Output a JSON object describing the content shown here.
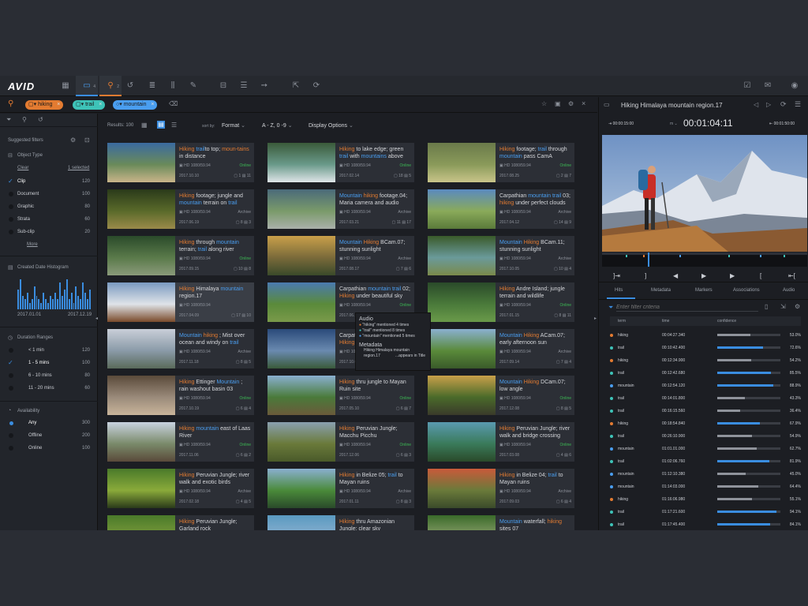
{
  "app": {
    "logo": "AVID"
  },
  "topbar": {
    "icons": [
      "grid-icon",
      "folder-icon",
      "search-icon",
      "history-icon",
      "list-icon",
      "bin-icon",
      "edit-icon",
      "sequence-icon",
      "timeline-icon",
      "arrow-icon",
      "export-icon",
      "refresh-search-icon"
    ],
    "folder_badge": "4",
    "search_badge": "2",
    "right_icons": [
      "check-icon",
      "mail-icon",
      "user-icon"
    ]
  },
  "search": {
    "chips": [
      {
        "label": "hiking",
        "color": "#e37b31"
      },
      {
        "label": "trail",
        "color": "#3ec3b8"
      },
      {
        "label": "mountain",
        "color": "#4a9ef0"
      }
    ]
  },
  "filters": {
    "title": "Suggested filters",
    "object_type": {
      "title": "Object Type",
      "clear": "Clear",
      "selected": "1 selected",
      "items": [
        {
          "label": "Clip",
          "count": "120",
          "checked": true
        },
        {
          "label": "Document",
          "count": "100",
          "checked": false
        },
        {
          "label": "Graphic",
          "count": "80",
          "checked": false
        },
        {
          "label": "Strata",
          "count": "60",
          "checked": false
        },
        {
          "label": "Sub-clip",
          "count": "20",
          "checked": false
        }
      ],
      "more": "More"
    },
    "histogram": {
      "title": "Created Date Histogram",
      "start": "2017.01.01",
      "end": "2017.12.19",
      "values": [
        0.6,
        0.9,
        0.4,
        0.3,
        0.5,
        0.2,
        0.3,
        0.7,
        0.4,
        0.3,
        0.2,
        0.5,
        0.3,
        0.2,
        0.4,
        0.3,
        0.5,
        0.3,
        0.8,
        0.4,
        0.6,
        0.9,
        0.3,
        0.5,
        0.2,
        0.7,
        0.4,
        0.3,
        0.8,
        0.5,
        0.3,
        0.6
      ]
    },
    "duration": {
      "title": "Duration Ranges",
      "items": [
        {
          "label": "< 1 min",
          "count": "120",
          "checked": false
        },
        {
          "label": "1 - 5 mins",
          "count": "100",
          "checked": true
        },
        {
          "label": "6 - 10 mins",
          "count": "80",
          "checked": false
        },
        {
          "label": "11 - 20 mins",
          "count": "60",
          "checked": false
        }
      ]
    },
    "availability": {
      "title": "Availability",
      "items": [
        {
          "label": "Any",
          "count": "300",
          "active": true
        },
        {
          "label": "Offline",
          "count": "200",
          "active": false
        },
        {
          "label": "Online",
          "count": "100",
          "active": false
        }
      ]
    }
  },
  "results": {
    "count_label": "Results: 100",
    "sort_by": "sort by:",
    "sort_value": "Format",
    "order_value": "A - Z, 0 -9",
    "display_options": "Display Options"
  },
  "cards": [
    {
      "title": [
        [
          "o",
          "Hiking"
        ],
        [
          " ",
          ""
        ],
        [
          "b",
          "trail"
        ],
        [
          "",
          "to top; "
        ],
        [
          "o",
          "moun-tains"
        ],
        [
          "",
          " in distance"
        ]
      ],
      "hd": "HD 1080/59.94",
      "status": "Online",
      "date": "2017.10.10",
      "c1": "1",
      "c2": "11",
      "thumb": [
        "#3a6aa0",
        "#6a8a5a",
        "#c9b58a"
      ]
    },
    {
      "title": [
        [
          "o",
          "Hiking"
        ],
        [
          "",
          " to lake edge; green "
        ],
        [
          "b",
          "trail"
        ],
        [
          "",
          " with "
        ],
        [
          "b",
          "mountains"
        ],
        [
          "",
          " above"
        ]
      ],
      "hd": "HD 1080/59.94",
      "status": "Online",
      "date": "2017.02.14",
      "c1": "18",
      "c2": "5",
      "thumb": [
        "#3a5a3a",
        "#6a9a8a",
        "#dfe5e8"
      ]
    },
    {
      "title": [
        [
          "o",
          "Hiking"
        ],
        [
          "",
          " footage; "
        ],
        [
          "b",
          "trail"
        ],
        [
          "",
          " through "
        ],
        [
          "b",
          "mountain"
        ],
        [
          "",
          " pass CamA"
        ]
      ],
      "hd": "HD 1080/59.94",
      "status": "Online",
      "date": "2017.08.25",
      "c1": "2",
      "c2": "7",
      "thumb": [
        "#6a7a4a",
        "#8a9a5a",
        "#c9c58a"
      ]
    },
    {
      "title": [
        [
          "o",
          "Hiking"
        ],
        [
          "",
          " footage; jungle and "
        ],
        [
          "b",
          "mountain"
        ],
        [
          "",
          " terrain on "
        ],
        [
          "b",
          "trail"
        ]
      ],
      "hd": "HD 1080/59.94",
      "status": "Archive",
      "date": "2017.06.19",
      "c1": "8",
      "c2": "3",
      "thumb": [
        "#2a3a1a",
        "#5a6a2a",
        "#9a8a4a"
      ]
    },
    {
      "title": [
        [
          "b",
          "Mountain"
        ],
        [
          " ",
          ""
        ],
        [
          "o",
          "hiking"
        ],
        [
          "",
          " footage.04; Maria camera and audio"
        ]
      ],
      "hd": "HD 1080/59.94",
      "status": "Archive",
      "date": "2017.03.21",
      "c1": "11",
      "c2": "17",
      "thumb": [
        "#4a6a7a",
        "#7a9a6a",
        "#aab0aa"
      ]
    },
    {
      "title": [
        [
          "",
          "Carpathian "
        ],
        [
          "b",
          "mountain trail"
        ],
        [
          "",
          " 03; "
        ],
        [
          "o",
          "hiking"
        ],
        [
          "",
          " under perfect clouds"
        ]
      ],
      "hd": "HD 1080/59.94",
      "status": "Archive",
      "date": "2017.04.12",
      "c1": "14",
      "c2": "9",
      "thumb": [
        "#5a8ac0",
        "#8aaa5a",
        "#5a7a3a"
      ]
    },
    {
      "title": [
        [
          "o",
          "Hiking"
        ],
        [
          "",
          " through "
        ],
        [
          "b",
          "mountain"
        ],
        [
          "",
          " terrain; "
        ],
        [
          "b",
          "trail"
        ],
        [
          "",
          " along river"
        ]
      ],
      "hd": "HD 1080/59.94",
      "status": "Online",
      "date": "2017.09.15",
      "c1": "10",
      "c2": "8",
      "thumb": [
        "#2a4a2a",
        "#5a7a4a",
        "#8a9a7a"
      ]
    },
    {
      "title": [
        [
          "b",
          "Mountain"
        ],
        [
          " ",
          ""
        ],
        [
          "o",
          "Hiking"
        ],
        [
          "",
          " BCam.07; stunning sunlight"
        ]
      ],
      "hd": "HD 1080/59.94",
      "status": "Archive",
      "date": "2017.08.17",
      "c1": "7",
      "c2": "6",
      "thumb": [
        "#c9a04a",
        "#7a6a3a",
        "#3a4a2a"
      ]
    },
    {
      "title": [
        [
          "b",
          "Mountain"
        ],
        [
          " ",
          ""
        ],
        [
          "o",
          "Hiking"
        ],
        [
          "",
          " BCam.11; stunning sunlight"
        ]
      ],
      "hd": "HD 1080/59.94",
      "status": "Archive",
      "date": "2017.10.05",
      "c1": "10",
      "c2": "4",
      "thumb": [
        "#3a5a2a",
        "#6a9a9a",
        "#7a8a4a"
      ]
    },
    {
      "title": [
        [
          "o",
          "Hiking"
        ],
        [
          "",
          " Himalaya "
        ],
        [
          "b",
          "mountain"
        ],
        [
          "",
          " region.17"
        ]
      ],
      "hd": "HD 1080/59.94",
      "status": "",
      "date": "2017.04.09",
      "c1": "17",
      "c2": "10",
      "thumb": [
        "#7a9ac0",
        "#dfe3e8",
        "#7a4a2a"
      ],
      "selected": true
    },
    {
      "title": [
        [
          "",
          "Carpathian "
        ],
        [
          "b",
          "mountain trail"
        ],
        [
          "",
          " 02; "
        ],
        [
          "o",
          "Hiking"
        ],
        [
          "",
          " under beautiful sky"
        ]
      ],
      "hd": "HD 1080/59.94",
      "status": "Online",
      "date": "2017.06.11",
      "c1": "9",
      "c2": "8",
      "thumb": [
        "#4a7ab0",
        "#5a8a3a",
        "#7a9a4a"
      ]
    },
    {
      "title": [
        [
          "o",
          "Hiking"
        ],
        [
          "",
          " Andre Island; jungle terrain and wildlife"
        ]
      ],
      "hd": "HD 1080/59.94",
      "status": "Online",
      "date": "2017.01.15",
      "c1": "8",
      "c2": "11",
      "thumb": [
        "#2a4a2a",
        "#4a7a3a",
        "#6a9a4a"
      ]
    },
    {
      "title": [
        [
          "b",
          "Mountain"
        ],
        [
          " ",
          ""
        ],
        [
          "o",
          "hiking"
        ],
        [
          "",
          " ; Mist over ocean and windy on "
        ],
        [
          "b",
          "trail"
        ]
      ],
      "hd": "HD 1080/59.94",
      "status": "Archive",
      "date": "2017.11.18",
      "c1": "8",
      "c2": "5",
      "thumb": [
        "#c9cfd8",
        "#8a9aa8",
        "#5a6a5a"
      ]
    },
    {
      "title": [
        [
          "",
          "Carpathian "
        ],
        [
          "b",
          "mountains"
        ],
        [
          "",
          " 18; "
        ],
        [
          "o",
          "Hiking"
        ],
        [
          "",
          " under beautiful sky"
        ]
      ],
      "hd": "HD 1080/59.94",
      "status": "Archive",
      "date": "2017.10.02",
      "c1": "14",
      "c2": "4",
      "thumb": [
        "#2a4a7a",
        "#6a8ab0",
        "#3a5a3a"
      ]
    },
    {
      "title": [
        [
          "b",
          "Mountain"
        ],
        [
          " ",
          ""
        ],
        [
          "o",
          "Hiking"
        ],
        [
          "",
          " ACam.07; early afternoon sun"
        ]
      ],
      "hd": "HD 1080/59.94",
      "status": "Archive",
      "date": "2017.09.14",
      "c1": "7",
      "c2": "4",
      "thumb": [
        "#8ab0d0",
        "#5a8a3a",
        "#3a5a2a"
      ]
    },
    {
      "title": [
        [
          "o",
          "Hiking"
        ],
        [
          "",
          " Ettinger "
        ],
        [
          "b",
          "Mountain"
        ],
        [
          "",
          " ; rain washout basin 03"
        ]
      ],
      "hd": "HD 1080/59.94",
      "status": "Online",
      "date": "2017.10.19",
      "c1": "6",
      "c2": "4",
      "thumb": [
        "#5a4a3a",
        "#9a8a7a",
        "#c9b59a"
      ]
    },
    {
      "title": [
        [
          "o",
          "Hiking"
        ],
        [
          "",
          " thru jungle to Mayan Ruin site"
        ]
      ],
      "hd": "HD 1080/59.94",
      "status": "Online",
      "date": "2017.05.10",
      "c1": "6",
      "c2": "7",
      "thumb": [
        "#8ab0d0",
        "#4a7a3a",
        "#6a5a3a"
      ]
    },
    {
      "title": [
        [
          "b",
          "Mountain"
        ],
        [
          " ",
          ""
        ],
        [
          "o",
          "Hiking"
        ],
        [
          "",
          " DCam.07; low angle"
        ]
      ],
      "hd": "HD 1080/59.94",
      "status": "Online",
      "date": "2017.12.08",
      "c1": "8",
      "c2": "5",
      "thumb": [
        "#c9a04a",
        "#4a6a2a",
        "#3a3a2a"
      ]
    },
    {
      "title": [
        [
          "o",
          "Hiking"
        ],
        [
          " ",
          ""
        ],
        [
          "b",
          "mountain"
        ],
        [
          "",
          " east of Laas River"
        ]
      ],
      "hd": "HD 1080/59.94",
      "status": "Online",
      "date": "2017.11.06",
      "c1": "6",
      "c2": "2",
      "thumb": [
        "#c9d3e0",
        "#7a8a6a",
        "#5a4a3a"
      ]
    },
    {
      "title": [
        [
          "o",
          "Hiking"
        ],
        [
          "",
          " Peruvian Jungle; Macchu Picchu"
        ]
      ],
      "hd": "HD 1080/59.94",
      "status": "Online",
      "date": "2017.12.06",
      "c1": "6",
      "c2": "3",
      "thumb": [
        "#8aa0b0",
        "#6a7a3a",
        "#4a5a2a"
      ]
    },
    {
      "title": [
        [
          "o",
          "Hiking"
        ],
        [
          "",
          " Peruvian Jungle; river walk and bridge crossing"
        ]
      ],
      "hd": "HD 1080/59.94",
      "status": "Online",
      "date": "2017.03.08",
      "c1": "4",
      "c2": "6",
      "thumb": [
        "#5a9ab0",
        "#3a7a5a",
        "#2a4a2a"
      ]
    },
    {
      "title": [
        [
          "o",
          "Hiking"
        ],
        [
          "",
          " Peruvian Jungle; river walk and exotic birds"
        ]
      ],
      "hd": "HD 1080/59.94",
      "status": "Archive",
      "date": "2017.02.18",
      "c1": "4",
      "c2": "5",
      "thumb": [
        "#4a7a2a",
        "#8aaa3a",
        "#2a3a1a"
      ]
    },
    {
      "title": [
        [
          "o",
          "Hiking"
        ],
        [
          "",
          " in Belize 05; "
        ],
        [
          "b",
          "trail"
        ],
        [
          "",
          " to Mayan ruins"
        ]
      ],
      "hd": "HD 1080/59.94",
      "status": "Archive",
      "date": "2017.01.11",
      "c1": "8",
      "c2": "3",
      "thumb": [
        "#8ab0d0",
        "#4a8a3a",
        "#2a4a2a"
      ]
    },
    {
      "title": [
        [
          "o",
          "Hiking"
        ],
        [
          "",
          " in Belize 04; "
        ],
        [
          "b",
          "trail"
        ],
        [
          "",
          " to Mayan ruins"
        ]
      ],
      "hd": "HD 1080/59.94",
      "status": "Archive",
      "date": "2017.09.03",
      "c1": "6",
      "c2": "4",
      "thumb": [
        "#c95a3a",
        "#6a7a3a",
        "#3a4a2a"
      ]
    },
    {
      "title": [
        [
          "o",
          "Hiking"
        ],
        [
          "",
          " Peruvian Jungle; Garland rock"
        ]
      ],
      "hd": "",
      "status": "",
      "date": "",
      "c1": "",
      "c2": "",
      "thumb": [
        "#4a7a2a",
        "#7a9a3a",
        "#3a3a2a"
      ]
    },
    {
      "title": [
        [
          "o",
          "Hiking"
        ],
        [
          "",
          " thru Amazonian Jungle; clear sky"
        ]
      ],
      "hd": "",
      "status": "",
      "date": "",
      "c1": "",
      "c2": "",
      "thumb": [
        "#5a9ac0",
        "#8ab0d0",
        "#3a5a2a"
      ]
    },
    {
      "title": [
        [
          "b",
          "Mountain"
        ],
        [
          "",
          " waterfall; "
        ],
        [
          "o",
          "hiking"
        ],
        [
          "",
          " sites 07"
        ]
      ],
      "hd": "",
      "status": "",
      "date": "",
      "c1": "",
      "c2": "",
      "thumb": [
        "#3a6a2a",
        "#8aa06a",
        "#dfe3e0"
      ]
    }
  ],
  "popup": {
    "audio_title": "Audio",
    "audio_lines": [
      {
        "term": "\"hiking\"",
        "rest": " mentioned 4 times",
        "color": "#e37b31"
      },
      {
        "term": "\"trail\"",
        "rest": " mentioned 8 times",
        "color": "#3ec3b8"
      },
      {
        "term": "\"mountain\"",
        "rest": " mentioned 5 times",
        "color": "#4a9ef0"
      }
    ],
    "meta_title": "Metadata",
    "meta_line1": "Hiking Himalaya mountain",
    "meta_line2": "region.17",
    "meta_line3": "...appears in Title"
  },
  "preview": {
    "title": "Hiking Himalaya mountain region.17",
    "tc_in": "00:00:15:00",
    "tc_main": "00:01:04:11",
    "tc_out": "00:01:50:00",
    "tabs": [
      "Hits",
      "Metadata",
      "Markers",
      "Associations",
      "Audio"
    ],
    "filter_placeholder": "Enter filter criteria",
    "columns": [
      "term",
      "time",
      "confidence"
    ],
    "hits": [
      {
        "term": "hiking",
        "time": "00:04:27.340",
        "conf": "53.0%",
        "v": 0.53,
        "color": "#e37b31",
        "blue": false
      },
      {
        "term": "trail",
        "time": "00:10:42.400",
        "conf": "72.6%",
        "v": 0.726,
        "color": "#3ec3b8",
        "blue": true
      },
      {
        "term": "hiking",
        "time": "00:12:34.900",
        "conf": "54.2%",
        "v": 0.542,
        "color": "#e37b31",
        "blue": false
      },
      {
        "term": "trail",
        "time": "00:12:42.680",
        "conf": "85.5%",
        "v": 0.855,
        "color": "#3ec3b8",
        "blue": true
      },
      {
        "term": "mountain",
        "time": "00:12:54.120",
        "conf": "88.9%",
        "v": 0.889,
        "color": "#4a9ef0",
        "blue": true
      },
      {
        "term": "trail",
        "time": "00:14:01.800",
        "conf": "43.3%",
        "v": 0.433,
        "color": "#3ec3b8",
        "blue": false
      },
      {
        "term": "trail",
        "time": "00:16:15.560",
        "conf": "36.4%",
        "v": 0.364,
        "color": "#3ec3b8",
        "blue": false
      },
      {
        "term": "hiking",
        "time": "00:18:54.840",
        "conf": "67.9%",
        "v": 0.679,
        "color": "#e37b31",
        "blue": true
      },
      {
        "term": "trail",
        "time": "00:26:10.900",
        "conf": "54.9%",
        "v": 0.549,
        "color": "#3ec3b8",
        "blue": false
      },
      {
        "term": "mountain",
        "time": "01:01.01.000",
        "conf": "62.7%",
        "v": 0.627,
        "color": "#4a9ef0",
        "blue": false
      },
      {
        "term": "trail",
        "time": "01:02:06.760",
        "conf": "81.9%",
        "v": 0.819,
        "color": "#3ec3b8",
        "blue": true
      },
      {
        "term": "mountain",
        "time": "01:12:10.380",
        "conf": "45.0%",
        "v": 0.45,
        "color": "#4a9ef0",
        "blue": false
      },
      {
        "term": "mountain",
        "time": "01:14:03.000",
        "conf": "64.4%",
        "v": 0.644,
        "color": "#4a9ef0",
        "blue": false
      },
      {
        "term": "hiking",
        "time": "01:16:06.980",
        "conf": "55.1%",
        "v": 0.551,
        "color": "#e37b31",
        "blue": false
      },
      {
        "term": "trail",
        "time": "01:17:21.600",
        "conf": "94.1%",
        "v": 0.941,
        "color": "#3ec3b8",
        "blue": true
      },
      {
        "term": "trail",
        "time": "01:17:45.400",
        "conf": "84.1%",
        "v": 0.841,
        "color": "#3ec3b8",
        "blue": true
      }
    ]
  }
}
